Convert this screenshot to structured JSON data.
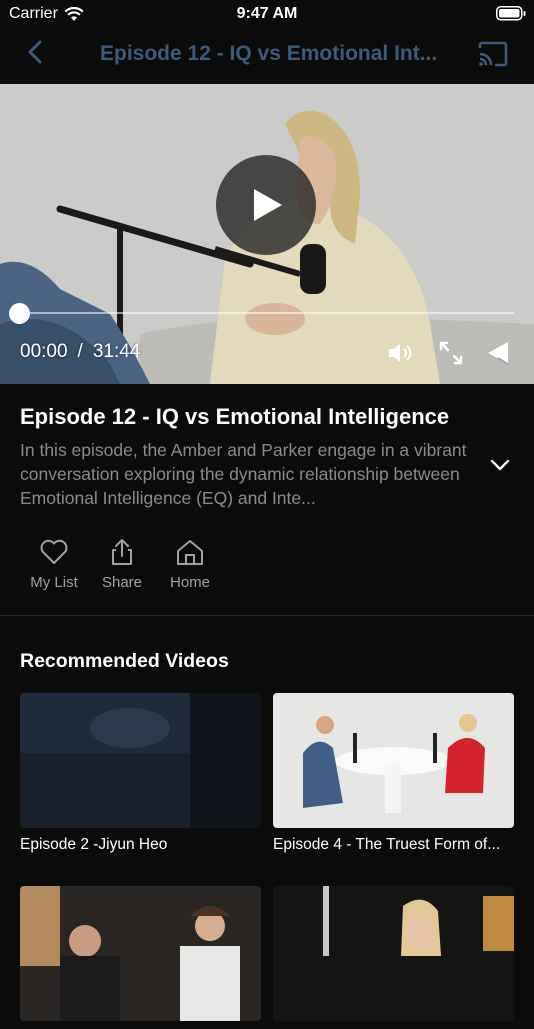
{
  "status_bar": {
    "carrier": "Carrier",
    "time": "9:47 AM"
  },
  "nav": {
    "title": "Episode 12 - IQ vs Emotional Int..."
  },
  "player": {
    "current_time": "00:00",
    "separator": "/",
    "duration": "31:44",
    "progress": 0
  },
  "episode": {
    "title": "Episode 12 - IQ vs Emotional Intelligence",
    "description": "In this episode, the Amber and Parker engage in a vibrant conversation exploring the dynamic relationship between Emotional Intelligence (EQ) and Inte..."
  },
  "actions": [
    {
      "label": "My List",
      "icon": "heart-icon"
    },
    {
      "label": "Share",
      "icon": "share-icon"
    },
    {
      "label": "Home",
      "icon": "home-icon"
    }
  ],
  "recommended": {
    "heading": "Recommended Videos",
    "items": [
      {
        "title": "Episode 2 -Jiyun Heo"
      },
      {
        "title": "Episode 4 - The Truest Form of..."
      },
      {
        "title": ""
      },
      {
        "title": ""
      }
    ]
  },
  "colors": {
    "background": "#0b0b0c",
    "nav_title": "#3f5a7a",
    "muted_text": "#8a8a8e"
  }
}
